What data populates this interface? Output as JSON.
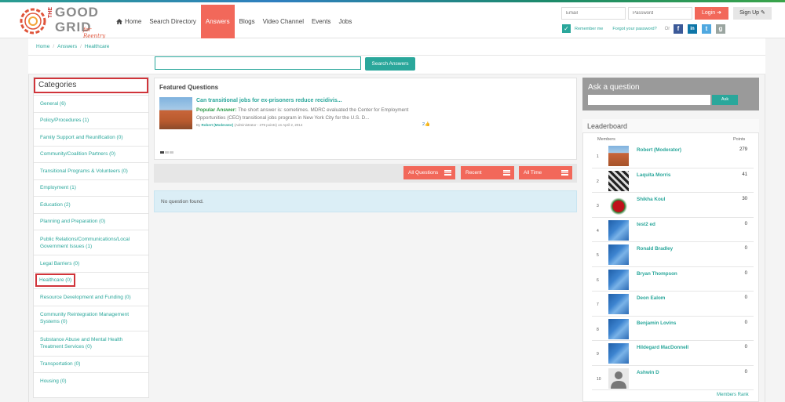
{
  "brand": {
    "the": "THE",
    "good": "GOOD",
    "grid": "GRID",
    "tagline": "for Reentry"
  },
  "nav": {
    "items": [
      {
        "label": "Home",
        "active": false
      },
      {
        "label": "Search Directory",
        "active": false
      },
      {
        "label": "Answers",
        "active": true
      },
      {
        "label": "Blogs",
        "active": false
      },
      {
        "label": "Video Channel",
        "active": false
      },
      {
        "label": "Events",
        "active": false
      },
      {
        "label": "Jobs",
        "active": false
      }
    ]
  },
  "auth": {
    "email_placeholder": "Email",
    "password_placeholder": "Password",
    "login_label": "Login",
    "signup_label": "Sign Up",
    "remember_label": "Remember me",
    "forgot_label": "Forgot your password?",
    "or_label": "Or"
  },
  "social": [
    {
      "name": "facebook-icon",
      "glyph": "f",
      "color": "#3b5998"
    },
    {
      "name": "linkedin-icon",
      "glyph": "in",
      "color": "#0e76a8"
    },
    {
      "name": "twitter-icon",
      "glyph": "t",
      "color": "#4fa8e0"
    },
    {
      "name": "google-icon",
      "glyph": "g",
      "color": "#9aa5a0"
    }
  ],
  "breadcrumb": [
    "Home",
    "Answers",
    "Healthcare"
  ],
  "search": {
    "button_label": "Search Answers",
    "value": ""
  },
  "categories": {
    "title": "Categories",
    "items": [
      {
        "label": "General (6)",
        "tall": false,
        "highlighted": false
      },
      {
        "label": "Policy/Procedures (1)",
        "tall": false,
        "highlighted": false
      },
      {
        "label": "Family Support and Reunification (0)",
        "tall": false,
        "highlighted": false
      },
      {
        "label": "Community/Coalition Partners (0)",
        "tall": false,
        "highlighted": false
      },
      {
        "label": "Transitional Programs & Volunteers (0)",
        "tall": false,
        "highlighted": false
      },
      {
        "label": "Employment (1)",
        "tall": false,
        "highlighted": false
      },
      {
        "label": "Education (2)",
        "tall": false,
        "highlighted": false
      },
      {
        "label": "Planning and Preparation (0)",
        "tall": false,
        "highlighted": false
      },
      {
        "label": "Public Relations/Communications/Local Government Issues (1)",
        "tall": true,
        "highlighted": false
      },
      {
        "label": "Legal Barriers (0)",
        "tall": false,
        "highlighted": false
      },
      {
        "label": "Healthcare (0)",
        "tall": false,
        "highlighted": true
      },
      {
        "label": "Resource Development and Funding (0)",
        "tall": false,
        "highlighted": false
      },
      {
        "label": "Community Reintegration Management Systems (0)",
        "tall": true,
        "highlighted": false
      },
      {
        "label": "Substance Abuse and Mental Health Treatment Services (0)",
        "tall": true,
        "highlighted": false
      },
      {
        "label": "Transportation (0)",
        "tall": false,
        "highlighted": false
      },
      {
        "label": "Housing (0)",
        "tall": false,
        "highlighted": false
      }
    ]
  },
  "featured": {
    "title": "Featured Questions",
    "question": "Can transitional jobs for ex-prisoners reduce recidivis...",
    "popular_label": "Popular Answer:",
    "answer": "The short answer is: sometimes. MDRC evaluated the Center for Employment Opportunities (CEO) transitional jobs program in New York City for the U.S. D...",
    "by_label": "By",
    "author": "Robert (Moderator)",
    "author_role": "(Administrator - 279 points)",
    "date": "on April 2, 2014",
    "count": "2"
  },
  "filters": [
    {
      "label": "All Questions"
    },
    {
      "label": "Recent"
    },
    {
      "label": "All Time"
    }
  ],
  "empty_message": "No question found.",
  "ask": {
    "title": "Ask a question",
    "button_label": "Ask"
  },
  "leaderboard": {
    "title": "Leaderboard",
    "col_members": "Members",
    "col_points": "Points",
    "more_label": "Members Rank",
    "rows": [
      {
        "rank": "1",
        "name": "Robert (Moderator)",
        "points": "279",
        "avatar": "canyon"
      },
      {
        "rank": "2",
        "name": "Laquita Morris",
        "points": "41",
        "avatar": "bw"
      },
      {
        "rank": "3",
        "name": "Shikha Koul",
        "points": "30",
        "avatar": "rose"
      },
      {
        "rank": "4",
        "name": "test2 ed",
        "points": "0",
        "avatar": "blue"
      },
      {
        "rank": "5",
        "name": "Ronald Bradley",
        "points": "0",
        "avatar": "blue"
      },
      {
        "rank": "6",
        "name": "Bryan Thompson",
        "points": "0",
        "avatar": "blue"
      },
      {
        "rank": "7",
        "name": "Deon Ealom",
        "points": "0",
        "avatar": "blue"
      },
      {
        "rank": "8",
        "name": "Benjamin Lovins",
        "points": "0",
        "avatar": "blue"
      },
      {
        "rank": "9",
        "name": "Hildegard MacDonnell",
        "points": "0",
        "avatar": "blue"
      },
      {
        "rank": "10",
        "name": "Ashwin D",
        "points": "0",
        "avatar": "user"
      }
    ]
  }
}
